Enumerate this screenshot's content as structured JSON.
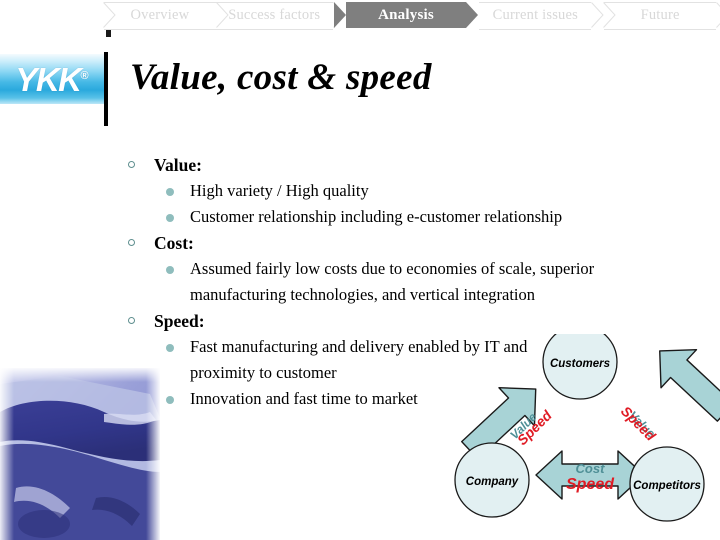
{
  "nav": {
    "tabs": [
      {
        "label": "Overview",
        "state": "inactive"
      },
      {
        "label": "Success factors",
        "state": "inactive"
      },
      {
        "label": "Analysis",
        "state": "active"
      },
      {
        "label": "Current issues",
        "state": "inactive"
      },
      {
        "label": "Future",
        "state": "inactive"
      }
    ],
    "active_color": "#7f7f7f",
    "inactive_color": "#d8d8d8"
  },
  "logo": {
    "text": "YKK",
    "registered_mark": "®"
  },
  "title": "Value, cost & speed",
  "content": {
    "sections": [
      {
        "heading": "Value:",
        "items": [
          "High variety / High quality",
          "Customer relationship including e-customer relationship"
        ]
      },
      {
        "heading": "Cost:",
        "items": [
          "Assumed fairly low costs due to economies of scale, superior manufacturing technologies, and vertical integration"
        ]
      },
      {
        "heading": "Speed:",
        "items": [
          "Fast manufacturing and delivery enabled by IT and proximity to customer",
          "Innovation and fast time to market"
        ]
      }
    ]
  },
  "diagram": {
    "nodes": {
      "customers": "Customers",
      "company": "Company",
      "competitors": "Competitors"
    },
    "arrows": {
      "left": {
        "top_label": "Value",
        "bottom_label": "Speed"
      },
      "right": {
        "top_label": "Value",
        "bottom_label": "Speed"
      },
      "bottom": {
        "top_label": "Cost",
        "bottom_label": "Speed"
      }
    },
    "colors": {
      "node_fill": "#e2f0f2",
      "arrow_fill": "#a8d3d6",
      "value_text": "#4f8f96",
      "speed_text": "#e01b24"
    }
  }
}
